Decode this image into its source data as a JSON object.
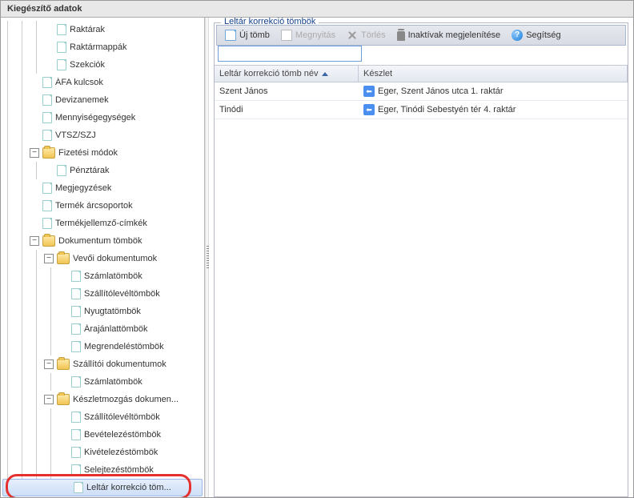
{
  "window": {
    "title": "Kiegészítő adatok"
  },
  "tree": {
    "raktarak": "Raktárak",
    "raktarmappak": "Raktármappák",
    "szekciok": "Szekciók",
    "afa": "ÁFA kulcsok",
    "deviza": "Devizanemek",
    "mennyiseg": "Mennyiségegységek",
    "vtsz": "VTSZ/SZJ",
    "fizetesi": "Fizetési módok",
    "penztarak": "Pénztárak",
    "megjegyzesek": "Megjegyzések",
    "arcsoportok": "Termék árcsoportok",
    "jellemzo": "Termékjellemző-címkék",
    "doktombok": "Dokumentum tömbök",
    "vevoi": "Vevői dokumentumok",
    "szamlatombok": "Számlatömbök",
    "szallitolevel1": "Szállítólevéltömbök",
    "nyugta": "Nyugtatömbök",
    "arajanlat": "Árajánlattömbök",
    "megrendeles": "Megrendeléstömbök",
    "szallitoi": "Szállítói dokumentumok",
    "szamlatombok2": "Számlatömbök",
    "keszletmozgas": "Készletmozgás dokumen...",
    "szallitolevel2": "Szállítólevéltömbök",
    "bevetelezes": "Bevételezéstömbök",
    "kivetelezes": "Kivételezéstömbök",
    "selejtezes": "Selejtezéstömbök",
    "leltarkorr": "Leltár korrekció töm..."
  },
  "main": {
    "legend": "Leltár korrekció tömbök",
    "toolbar": {
      "new": "Új tömb",
      "open": "Megnyitás",
      "delete": "Törlés",
      "inactive": "Inaktívak megjelenítése",
      "help": "Segítség"
    },
    "filter": {
      "value": ""
    },
    "columns": {
      "name": "Leltár korrekció tömb név",
      "keszlet": "Készlet"
    },
    "rows": [
      {
        "name": "Szent János",
        "keszlet": "Eger, Szent János utca 1. raktár"
      },
      {
        "name": "Tinódi",
        "keszlet": "Eger, Tinódi Sebestyén tér 4. raktár"
      }
    ]
  }
}
